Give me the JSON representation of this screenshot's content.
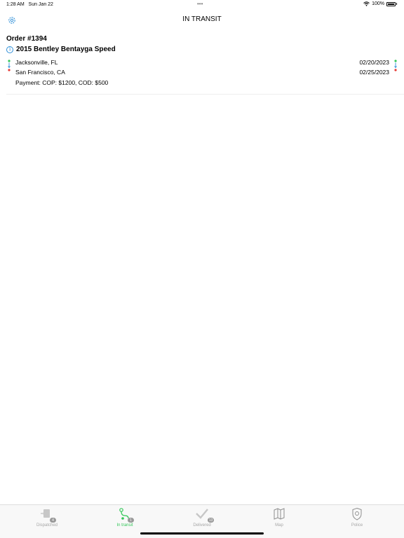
{
  "status_bar": {
    "time": "1:28 AM",
    "date": "Sun Jan 22",
    "battery": "100%"
  },
  "header": {
    "title": "IN TRANSIT"
  },
  "order": {
    "number": "Order #1394",
    "badge": "1",
    "vehicle": "2015 Bentley Bentayga Speed",
    "origin": "Jacksonville, FL",
    "destination": "San Francisco, CA",
    "pickup_date": "02/20/2023",
    "delivery_date": "02/25/2023",
    "payment": "Payment: COP: $1200, COD: $500"
  },
  "tabs": [
    {
      "label": "Dispatched",
      "icon": "dispatched-icon",
      "badge": "4"
    },
    {
      "label": "In transit",
      "icon": "route-icon",
      "badge": "1"
    },
    {
      "label": "Delivered",
      "icon": "checkmark-icon",
      "badge": "13"
    },
    {
      "label": "Map",
      "icon": "map-icon",
      "badge": ""
    },
    {
      "label": "Police",
      "icon": "police-badge-icon",
      "badge": ""
    }
  ],
  "colors": {
    "accent": "#2e8fd8",
    "active_tab": "#34c759",
    "origin_dot": "#34c759",
    "destination_dot": "#e53935"
  }
}
